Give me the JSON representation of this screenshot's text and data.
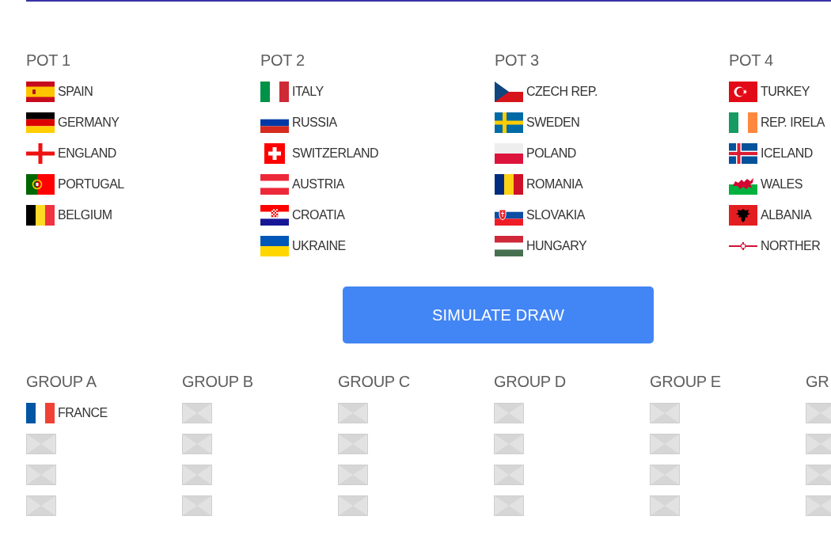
{
  "pots": [
    {
      "title": "POT 1",
      "teams": [
        {
          "name": "SPAIN",
          "kind": "spain"
        },
        {
          "name": "GERMANY",
          "kind": "germany"
        },
        {
          "name": "ENGLAND",
          "kind": "england"
        },
        {
          "name": "PORTUGAL",
          "kind": "portugal"
        },
        {
          "name": "BELGIUM",
          "kind": "belgium"
        }
      ]
    },
    {
      "title": "POT 2",
      "teams": [
        {
          "name": "ITALY",
          "kind": "italy"
        },
        {
          "name": "RUSSIA",
          "kind": "russia"
        },
        {
          "name": "SWITZERLAND",
          "kind": "switzerland"
        },
        {
          "name": "AUSTRIA",
          "kind": "austria"
        },
        {
          "name": "CROATIA",
          "kind": "croatia"
        },
        {
          "name": "UKRAINE",
          "kind": "ukraine"
        }
      ]
    },
    {
      "title": "POT 3",
      "teams": [
        {
          "name": "CZECH REP.",
          "kind": "czech"
        },
        {
          "name": "SWEDEN",
          "kind": "sweden"
        },
        {
          "name": "POLAND",
          "kind": "poland"
        },
        {
          "name": "ROMANIA",
          "kind": "romania"
        },
        {
          "name": "SLOVAKIA",
          "kind": "slovakia"
        },
        {
          "name": "HUNGARY",
          "kind": "hungary"
        }
      ]
    },
    {
      "title": "POT 4",
      "teams": [
        {
          "name": "TURKEY",
          "kind": "turkey"
        },
        {
          "name": "REP. IRELA",
          "kind": "ireland"
        },
        {
          "name": "ICELAND",
          "kind": "iceland"
        },
        {
          "name": "WALES",
          "kind": "wales"
        },
        {
          "name": "ALBANIA",
          "kind": "albania"
        },
        {
          "name": "NORTHER",
          "kind": "ulster"
        }
      ]
    }
  ],
  "simulate_button": {
    "label": "SIMULATE DRAW"
  },
  "groups": [
    {
      "title": "GROUP A",
      "slots": [
        {
          "kind": "france",
          "name": "FRANCE"
        },
        {
          "kind": "empty"
        },
        {
          "kind": "empty"
        },
        {
          "kind": "empty"
        }
      ]
    },
    {
      "title": "GROUP B",
      "slots": [
        {
          "kind": "empty"
        },
        {
          "kind": "empty"
        },
        {
          "kind": "empty"
        },
        {
          "kind": "empty"
        }
      ]
    },
    {
      "title": "GROUP C",
      "slots": [
        {
          "kind": "empty"
        },
        {
          "kind": "empty"
        },
        {
          "kind": "empty"
        },
        {
          "kind": "empty"
        }
      ]
    },
    {
      "title": "GROUP D",
      "slots": [
        {
          "kind": "empty"
        },
        {
          "kind": "empty"
        },
        {
          "kind": "empty"
        },
        {
          "kind": "empty"
        }
      ]
    },
    {
      "title": "GROUP E",
      "slots": [
        {
          "kind": "empty"
        },
        {
          "kind": "empty"
        },
        {
          "kind": "empty"
        },
        {
          "kind": "empty"
        }
      ]
    },
    {
      "title": "GR",
      "slots": [
        {
          "kind": "empty"
        },
        {
          "kind": "empty"
        },
        {
          "kind": "empty"
        },
        {
          "kind": "empty"
        }
      ]
    }
  ]
}
